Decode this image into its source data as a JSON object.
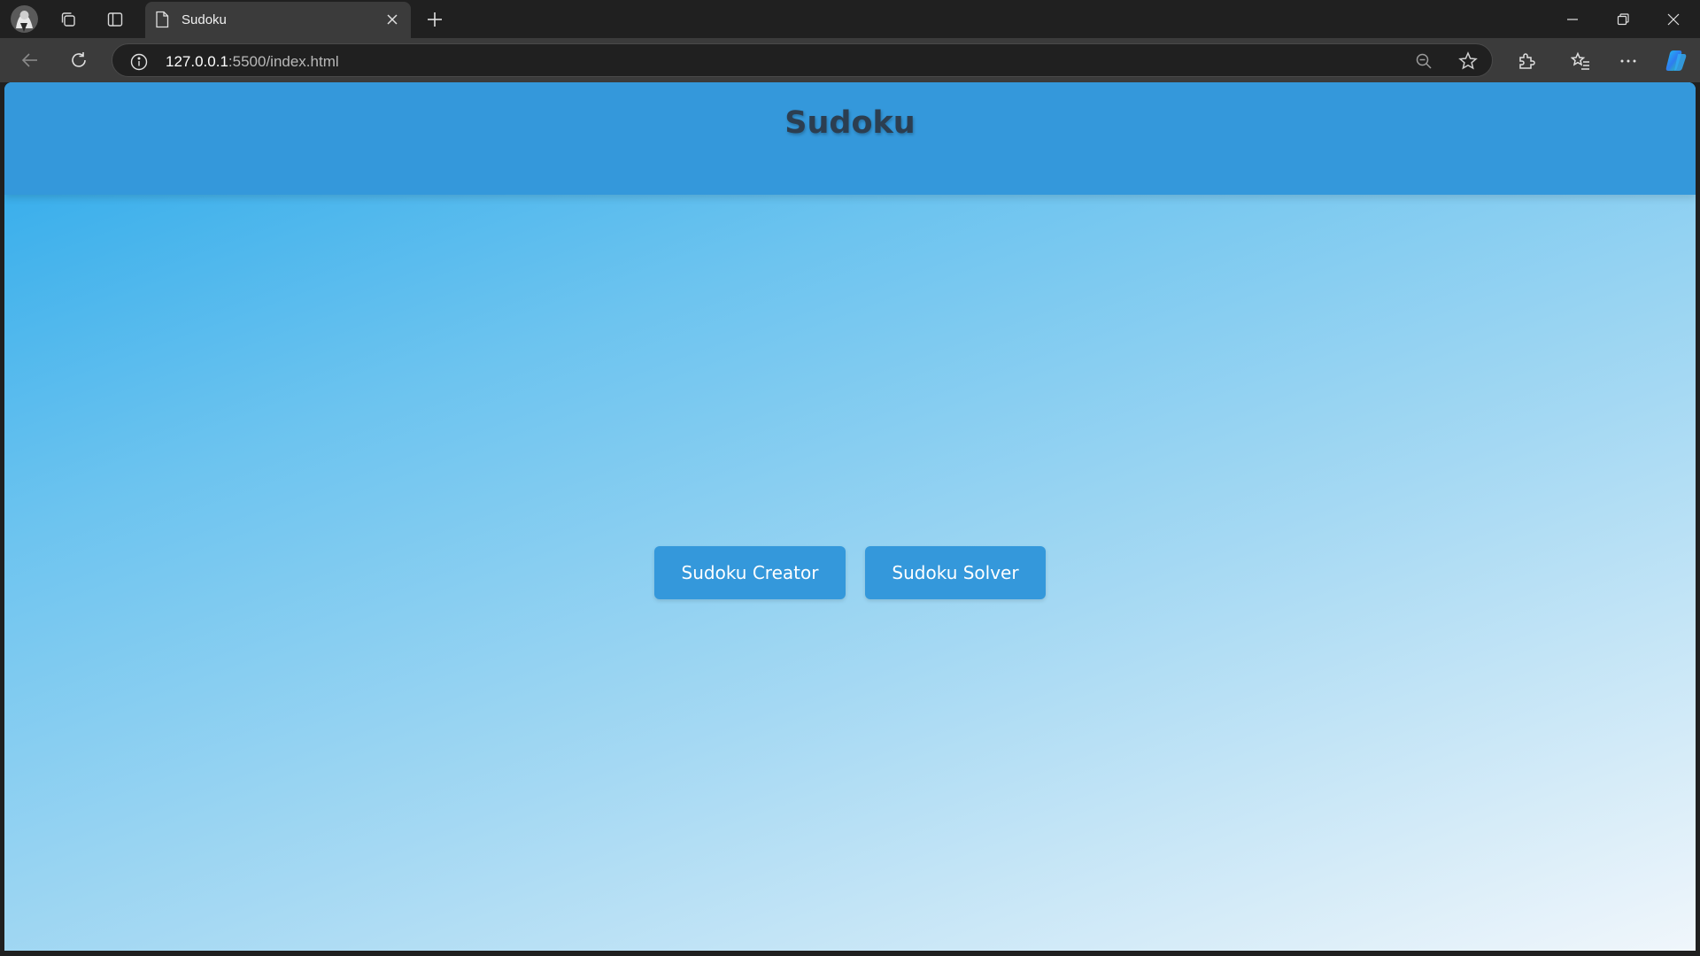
{
  "browser": {
    "tab": {
      "title": "Sudoku"
    },
    "address": {
      "host": "127.0.0.1",
      "rest": ":5500/index.html"
    },
    "accent_color": "#3498db"
  },
  "page": {
    "title": "Sudoku",
    "buttons": {
      "creator_label": "Sudoku Creator",
      "solver_label": "Sudoku Solver"
    }
  },
  "icons": [
    "profile-avatar",
    "workspaces-icon",
    "tab-actions-icon",
    "document-icon",
    "close-icon",
    "plus-icon",
    "minimize-icon",
    "restore-icon",
    "back-arrow-icon",
    "refresh-icon",
    "info-icon",
    "zoom-out-icon",
    "star-icon",
    "extensions-icon",
    "favorites-icon",
    "more-icon",
    "copilot-icon"
  ]
}
